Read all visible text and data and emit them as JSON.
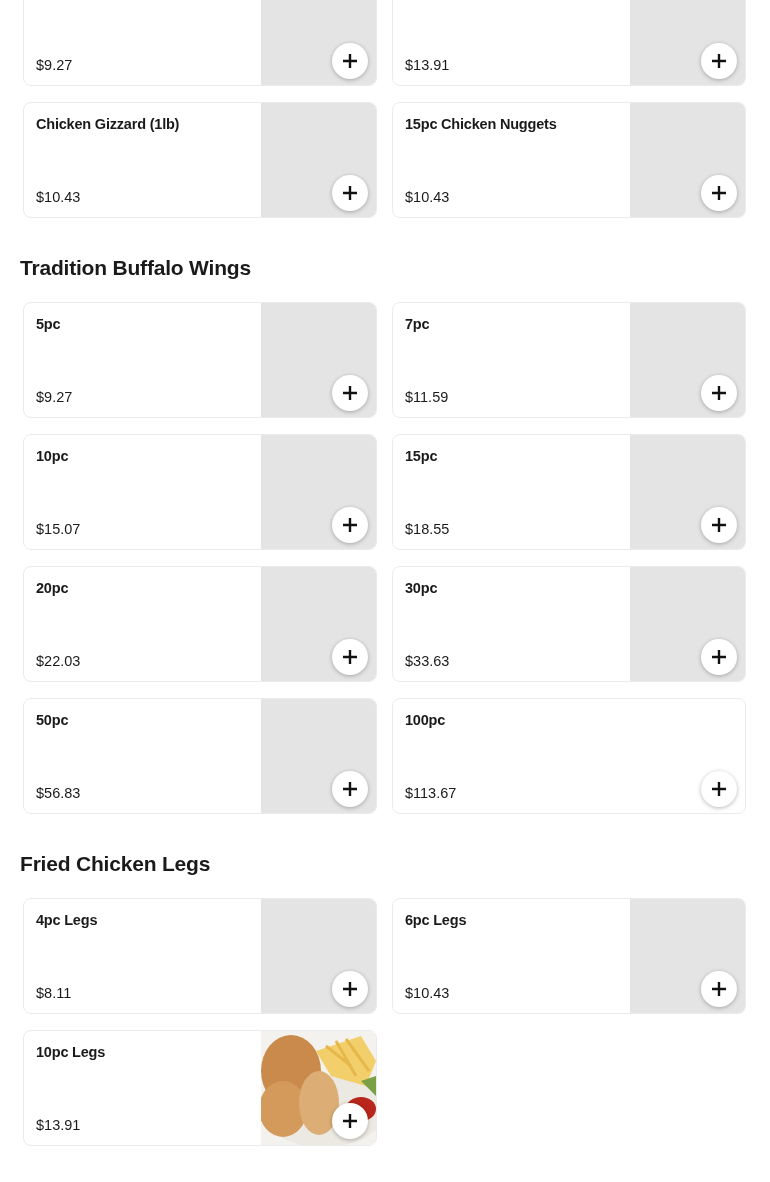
{
  "sections": [
    {
      "items": [
        {
          "price": "$9.27",
          "kind": "placeholder"
        },
        {
          "price": "$13.91",
          "kind": "placeholder"
        },
        {
          "name": "Chicken Gizzard (1lb)",
          "price": "$10.43",
          "kind": "placeholder"
        },
        {
          "name": "15pc Chicken Nuggets",
          "price": "$10.43",
          "kind": "placeholder"
        }
      ]
    },
    {
      "title": "Tradition Buffalo Wings",
      "items": [
        {
          "name": "5pc",
          "price": "$9.27",
          "kind": "placeholder"
        },
        {
          "name": "7pc",
          "price": "$11.59",
          "kind": "placeholder"
        },
        {
          "name": "10pc",
          "price": "$15.07",
          "kind": "placeholder"
        },
        {
          "name": "15pc",
          "price": "$18.55",
          "kind": "placeholder"
        },
        {
          "name": "20pc",
          "price": "$22.03",
          "kind": "placeholder"
        },
        {
          "name": "30pc",
          "price": "$33.63",
          "kind": "placeholder"
        },
        {
          "name": "50pc",
          "price": "$56.83",
          "kind": "placeholder"
        },
        {
          "name": "100pc",
          "price": "$113.67",
          "kind": "plain"
        }
      ]
    },
    {
      "title": "Fried Chicken Legs",
      "items": [
        {
          "name": "4pc Legs",
          "price": "$8.11",
          "kind": "placeholder"
        },
        {
          "name": "6pc Legs",
          "price": "$10.43",
          "kind": "placeholder"
        },
        {
          "name": "10pc Legs",
          "price": "$13.91",
          "kind": "picture"
        }
      ]
    }
  ]
}
